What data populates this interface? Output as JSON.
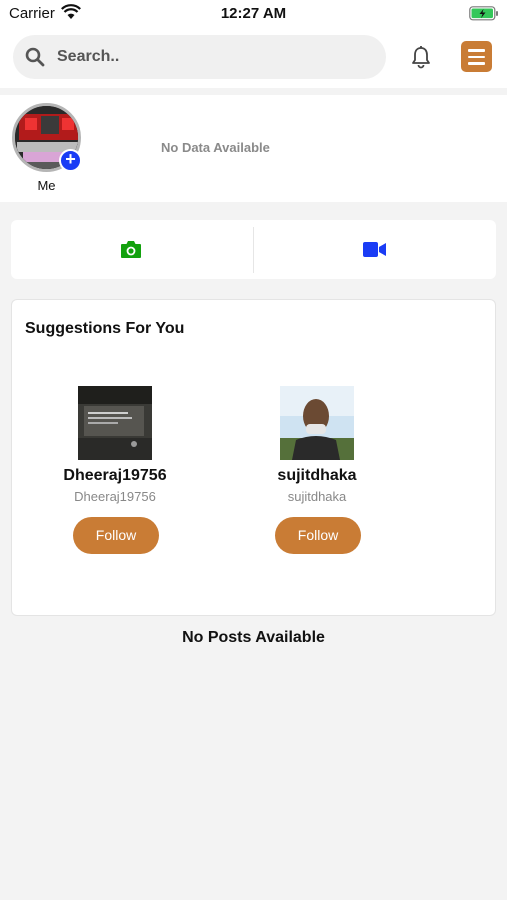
{
  "status_bar": {
    "carrier": "Carrier",
    "time": "12:27 AM"
  },
  "header": {
    "search_placeholder": "Search..",
    "icons": [
      "search-icon",
      "bell-icon",
      "hamburger-menu-icon"
    ]
  },
  "stories": {
    "me_label": "Me",
    "empty_text": "No Data Available"
  },
  "media": {
    "icons": [
      "camera-icon",
      "video-icon"
    ],
    "colors": {
      "camera": "#13a10e",
      "video": "#1a3cf5"
    }
  },
  "suggestions": {
    "title": "Suggestions For You",
    "users": [
      {
        "name": "Dheeraj19756",
        "handle": "Dheeraj19756",
        "follow_label": "Follow"
      },
      {
        "name": "sujitdhaka",
        "handle": "sujitdhaka",
        "follow_label": "Follow"
      }
    ]
  },
  "feed": {
    "empty_text": "No Posts Available"
  },
  "colors": {
    "accent": "#c97c35",
    "add_badge": "#1a3cf5"
  }
}
